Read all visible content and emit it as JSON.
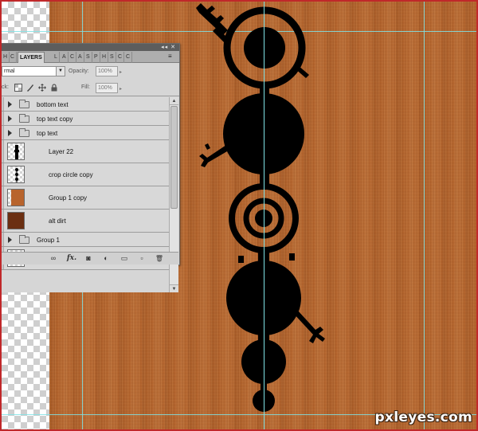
{
  "panel": {
    "title_controls": "◂◂ ✕",
    "tabs": [
      "H",
      "C",
      "LAYERS",
      "L",
      "A",
      "C",
      "A",
      "S",
      "P",
      "H",
      "S",
      "C",
      "C"
    ],
    "tab_menu": "≡",
    "blend_mode": "rmal",
    "opacity_label": "Opacity:",
    "opacity_value": "100%",
    "lock_label": "ck:",
    "fill_label": "Fill:",
    "fill_value": "100%",
    "layers": [
      {
        "name": "bottom text",
        "kind": "group"
      },
      {
        "name": "top text copy",
        "kind": "group"
      },
      {
        "name": "top text",
        "kind": "group"
      },
      {
        "name": "Layer 22",
        "kind": "pixel"
      },
      {
        "name": "crop circle copy",
        "kind": "pixel"
      },
      {
        "name": "Group 1 copy",
        "kind": "pixel"
      },
      {
        "name": "alt dirt",
        "kind": "pixel"
      },
      {
        "name": "Group 1",
        "kind": "group"
      }
    ],
    "bottom_icons": [
      "link-icon",
      "fx-icon",
      "mask-icon",
      "adjustment-icon",
      "folder-icon",
      "new-layer-icon",
      "trash-icon"
    ],
    "bottom_glyphs": [
      "∞",
      "fx.",
      "◙",
      "◐",
      "▭",
      "▫",
      "🗑"
    ]
  },
  "colors": {
    "wood": "#b5642c",
    "guide": "#7fe3e6",
    "panel_bg": "#d6d6d6",
    "orange_thumb": "#b8642d",
    "dark_brown_thumb": "#6b2f12"
  },
  "watermark": "pxleyes.com"
}
